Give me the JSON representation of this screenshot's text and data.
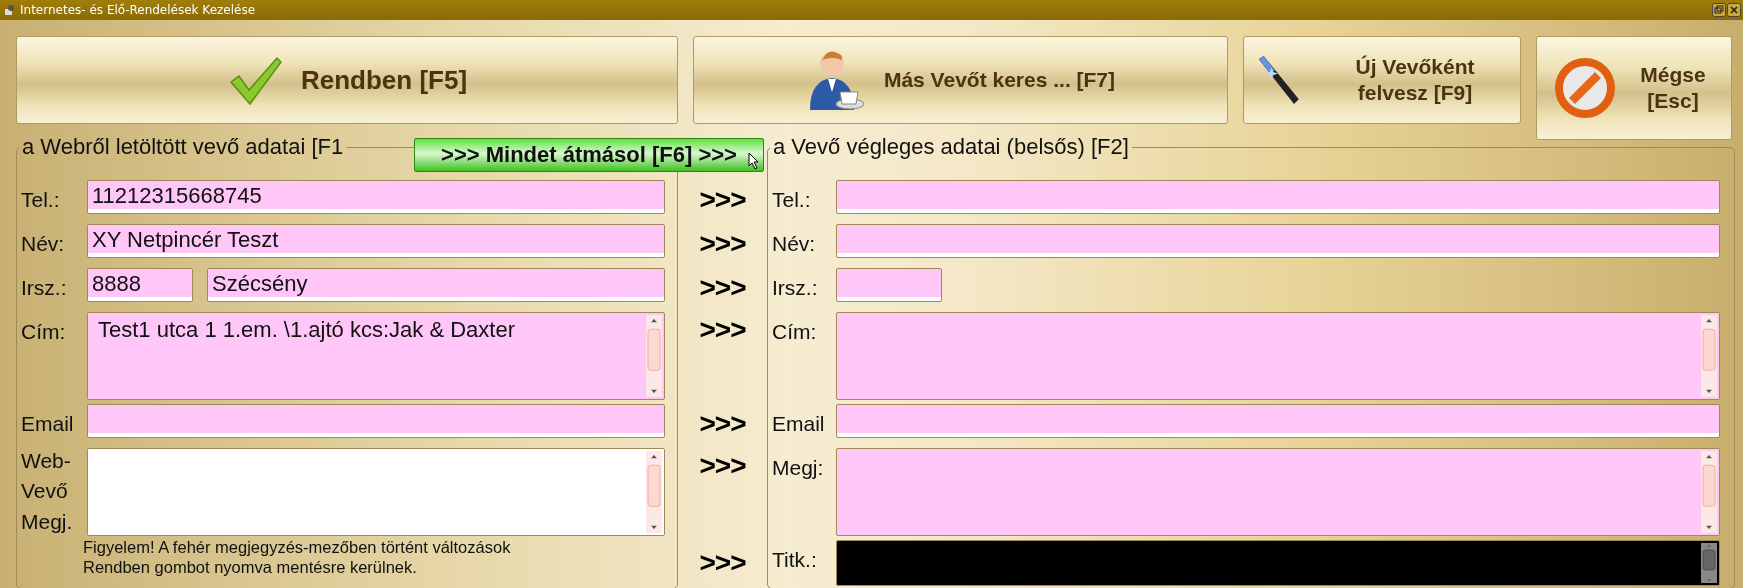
{
  "window": {
    "title": "Internetes- és Elő-Rendelések Kezelése"
  },
  "buttons": [
    {
      "kind": "ok",
      "label": "Rendben [F5]"
    },
    {
      "kind": "find",
      "label": "Más Vevőt keres ... [F7]"
    },
    {
      "kind": "new",
      "label": "Új Vevőként felvesz [F9]"
    },
    {
      "kind": "cancel",
      "label": "Mégse [Esc]"
    }
  ],
  "copy_all_button": {
    "label": ">>> Mindet átmásol [F6] >>>"
  },
  "web_customer": {
    "title": "a Webről letöltött vevő adatai [F1",
    "fields": [
      {
        "kind": "text",
        "label": "Tel.:",
        "value": "11212315668745"
      },
      {
        "kind": "text",
        "label": "Név:",
        "value": "XY Netpincér Teszt"
      },
      {
        "kind": "pair",
        "label": "Irsz.:",
        "value": "8888",
        "value_2": "Szécsény"
      },
      {
        "kind": "memo",
        "label": "Cím:",
        "value": "Test1 utca 1 1.em. \\1.ajtó kcs:Jak & Daxter"
      },
      {
        "kind": "text",
        "label": "Email"
      },
      {
        "kind": "note",
        "label": "Web-Vevő Megj."
      }
    ],
    "notice": [
      "Figyelem! A fehér megjegyzés-mezőben történt változások",
      "Rendben gombot nyomva mentésre kerülnek."
    ]
  },
  "final_customer": {
    "title": "a Vevő végleges adatai (belsős)  [F2]",
    "fields": [
      {
        "kind": "text",
        "label": "Tel.:",
        "arrow": ">>>"
      },
      {
        "kind": "text",
        "label": "Név:",
        "arrow": ">>>"
      },
      {
        "kind": "short",
        "label": "Irsz.:",
        "arrow": ">>>"
      },
      {
        "kind": "memo",
        "label": "Cím:",
        "arrow": ">>>"
      },
      {
        "kind": "text",
        "label": "Email",
        "arrow": ">>>"
      },
      {
        "kind": "memo",
        "label": "Megj:",
        "arrow": ">>>"
      },
      {
        "kind": "secret",
        "label": "Titk.:",
        "arrow": ">>>"
      }
    ]
  }
}
